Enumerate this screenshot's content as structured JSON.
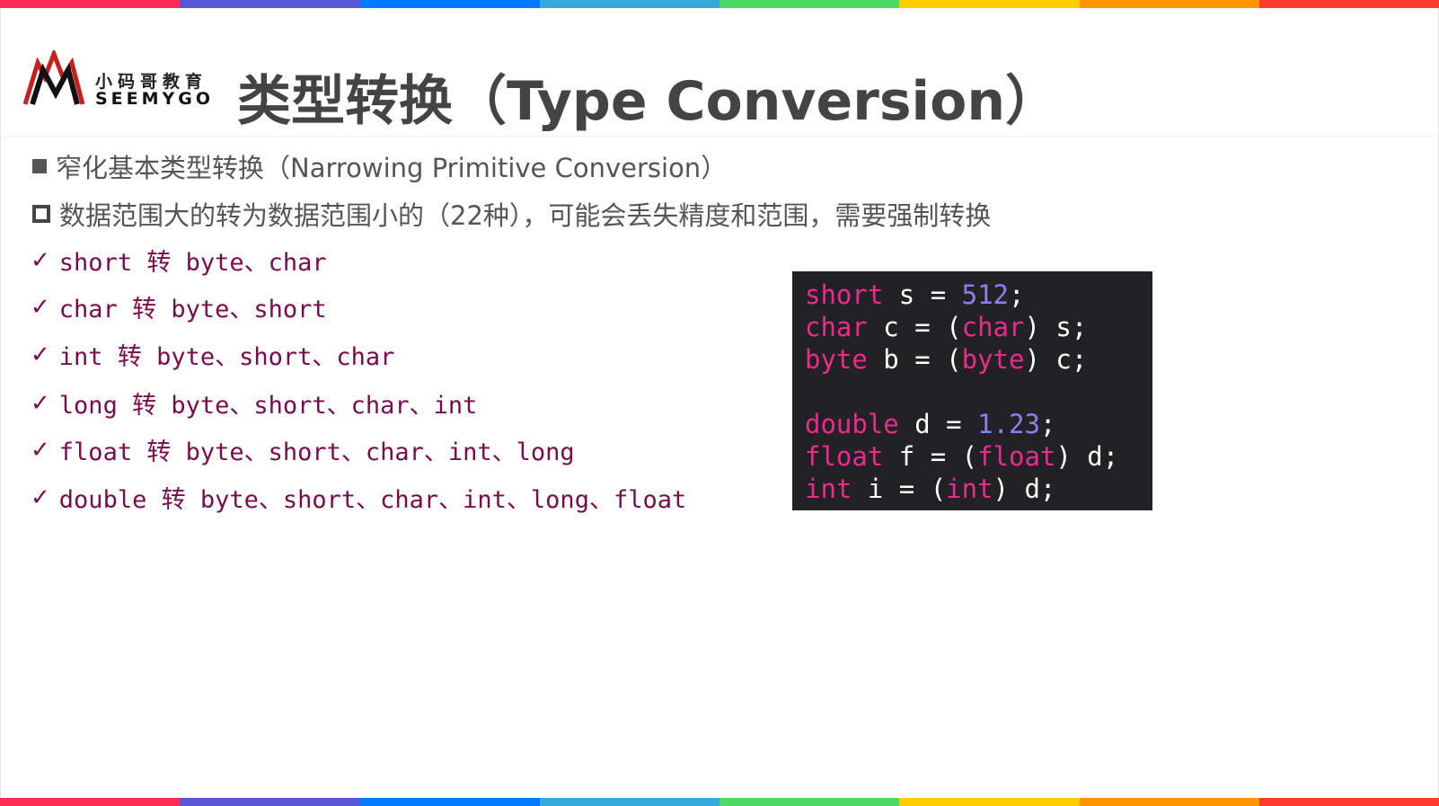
{
  "colors": {
    "rainbow": [
      "#ff2d55",
      "#5856d6",
      "#007aff",
      "#34aadc",
      "#4cd964",
      "#ffcc00",
      "#ff9500",
      "#ff3b30"
    ],
    "keyword": "#ec2b8c",
    "number": "#8b7ff0",
    "check_text": "#7a0a4e"
  },
  "logo": {
    "cn": "小码哥教育",
    "en": "SEEMYGO"
  },
  "title": "类型转换（Type Conversion）",
  "bullets": [
    "窄化基本类型转换（Narrowing Primitive Conversion）",
    "数据范围大的转为数据范围小的（22种），可能会丢失精度和范围，需要强制转换"
  ],
  "checks": [
    "short 转 byte、char",
    "char 转 byte、short",
    "int 转 byte、short、char",
    "long 转 byte、short、char、int",
    "float 转 byte、short、char、int、long",
    "double 转 byte、short、char、int、long、float"
  ],
  "check_mark": "✓",
  "code": [
    [
      [
        "kw",
        "short"
      ],
      [
        "",
        " s = "
      ],
      [
        "num",
        "512"
      ],
      [
        "",
        ";"
      ]
    ],
    [
      [
        "kw",
        "char"
      ],
      [
        "",
        " c = ("
      ],
      [
        "kw",
        "char"
      ],
      [
        "",
        ") s;"
      ]
    ],
    [
      [
        "kw",
        "byte"
      ],
      [
        "",
        " b = ("
      ],
      [
        "kw",
        "byte"
      ],
      [
        "",
        ") c;"
      ]
    ],
    [],
    [
      [
        "kw",
        "double"
      ],
      [
        "",
        " d = "
      ],
      [
        "num",
        "1.23"
      ],
      [
        "",
        ";"
      ]
    ],
    [
      [
        "kw",
        "float"
      ],
      [
        "",
        " f = ("
      ],
      [
        "kw",
        "float"
      ],
      [
        "",
        ") d;"
      ]
    ],
    [
      [
        "kw",
        "int"
      ],
      [
        "",
        " i = ("
      ],
      [
        "kw",
        "int"
      ],
      [
        "",
        ") d;"
      ]
    ]
  ]
}
